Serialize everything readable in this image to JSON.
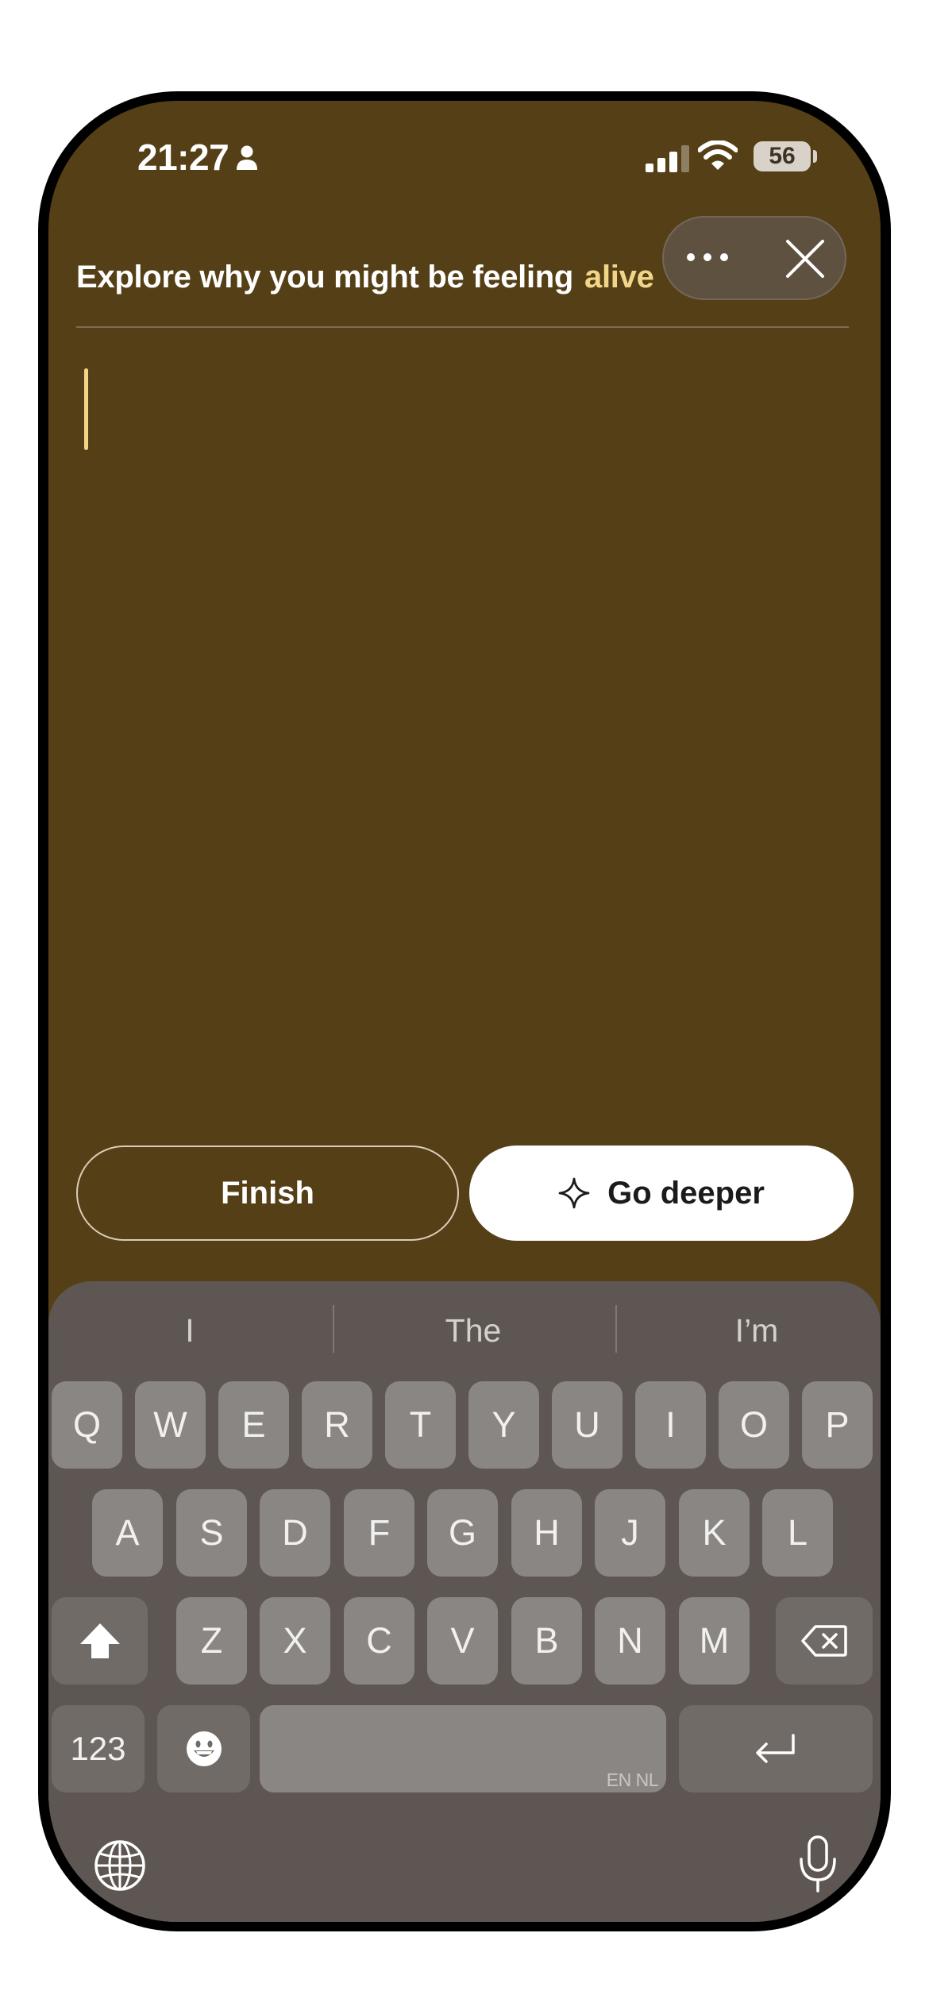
{
  "status_bar": {
    "time": "21:27",
    "battery": "56"
  },
  "header": {
    "prompt": "Explore why you might be feeling",
    "emotion": "alive",
    "emotion_color": "#f1d588"
  },
  "theme": {
    "background": "#553f16",
    "accent": "#f1d588"
  },
  "actions": {
    "finish_label": "Finish",
    "go_deeper_label": "Go deeper"
  },
  "keyboard": {
    "suggestions": [
      "I",
      "The",
      "I’m"
    ],
    "row1": [
      "Q",
      "W",
      "E",
      "R",
      "T",
      "Y",
      "U",
      "I",
      "O",
      "P"
    ],
    "row2": [
      "A",
      "S",
      "D",
      "F",
      "G",
      "H",
      "J",
      "K",
      "L"
    ],
    "row3": [
      "Z",
      "X",
      "C",
      "V",
      "B",
      "N",
      "M"
    ],
    "numbers_label": "123",
    "space_hint": "EN NL"
  }
}
